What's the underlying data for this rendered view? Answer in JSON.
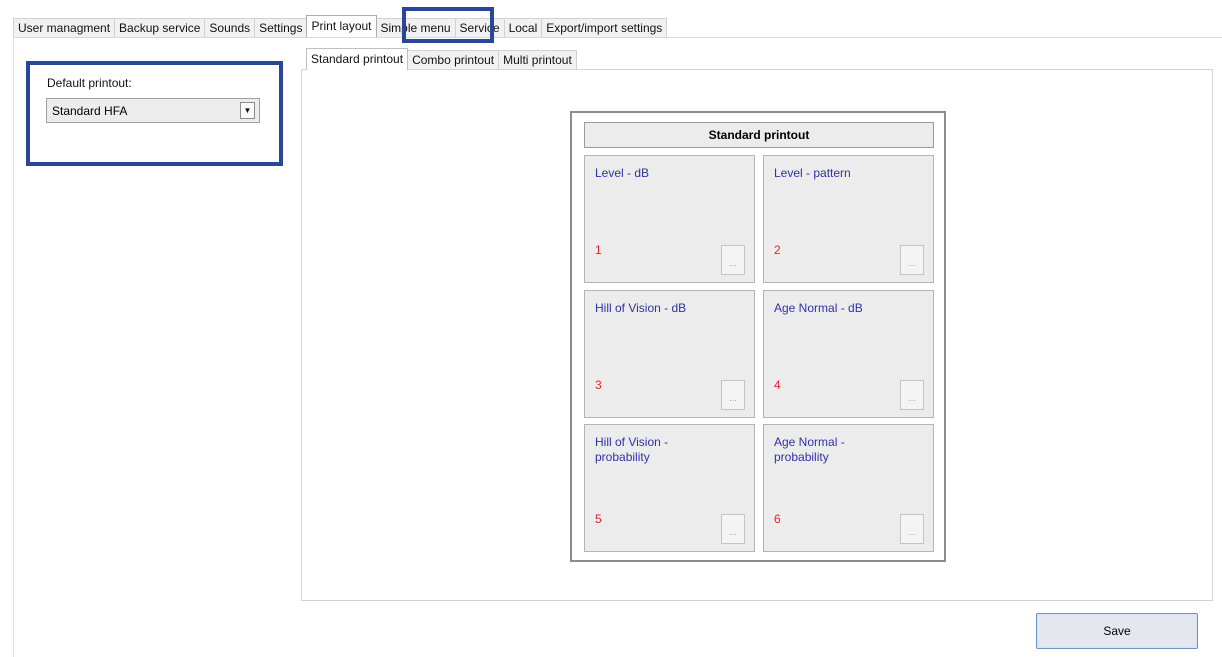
{
  "main_tabs": [
    {
      "label": "User managment"
    },
    {
      "label": "Backup service"
    },
    {
      "label": "Sounds"
    },
    {
      "label": "Settings"
    },
    {
      "label": "Print layout",
      "active": true
    },
    {
      "label": "Simple menu"
    },
    {
      "label": "Service"
    },
    {
      "label": "Local"
    },
    {
      "label": "Export/import settings"
    }
  ],
  "default_printout": {
    "label": "Default printout:",
    "selected": "Standard HFA"
  },
  "sub_tabs": [
    {
      "label": "Standard printout",
      "active": true
    },
    {
      "label": "Combo printout"
    },
    {
      "label": "Multi printout"
    }
  ],
  "printout": {
    "title": "Standard printout",
    "button_label": "...",
    "slots": [
      {
        "name": "Level - dB",
        "number": "1"
      },
      {
        "name": "Level - pattern",
        "number": "2"
      },
      {
        "name": "Hill of Vision - dB",
        "number": "3"
      },
      {
        "name": "Age Normal - dB",
        "number": "4"
      },
      {
        "name": "Hill of Vision - probability",
        "number": "5"
      },
      {
        "name": "Age Normal - probability",
        "number": "6"
      }
    ]
  },
  "save_label": "Save",
  "colors": {
    "highlight": "#2a4696",
    "slot_name": "#3131a8",
    "slot_number": "#e8242a"
  }
}
